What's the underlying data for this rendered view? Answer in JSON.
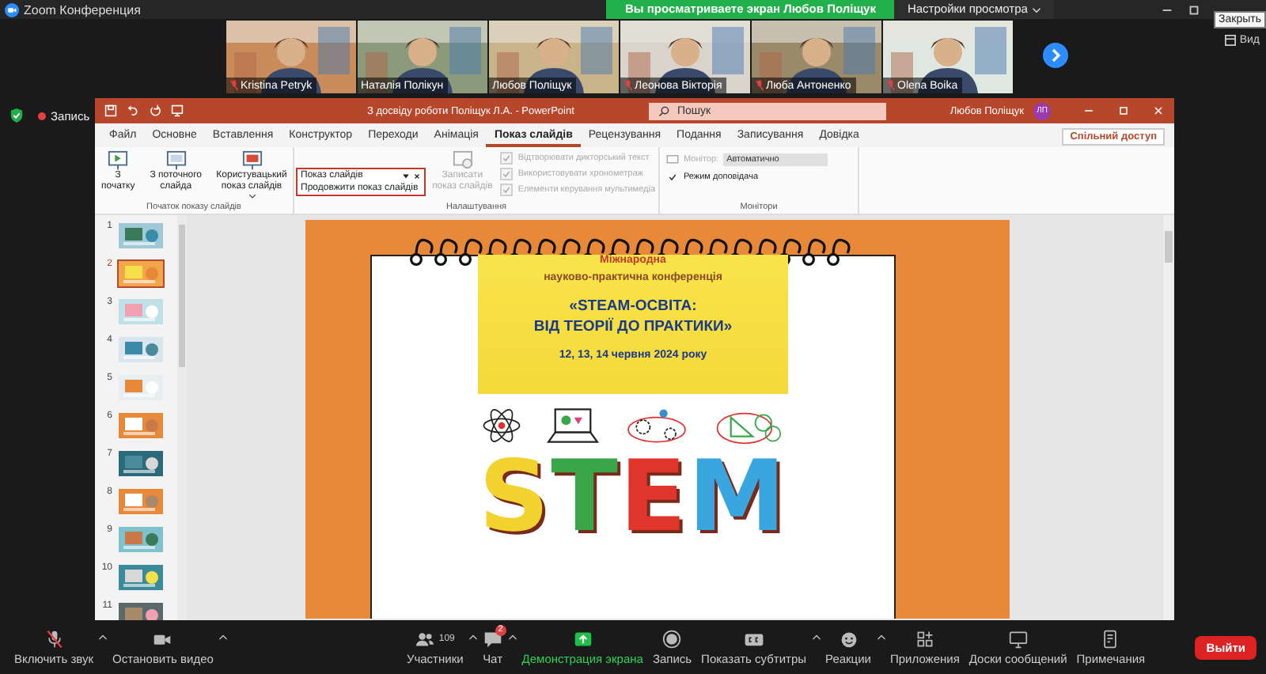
{
  "app": {
    "title": "Zoom Конференция",
    "banner": "Вы просматриваете экран Любов Поліщук",
    "view_options": "Настройки просмотра",
    "close_tooltip": "Закрыть",
    "view_button": "Вид"
  },
  "participants": [
    {
      "name": "Kristina Petryk",
      "muted": true
    },
    {
      "name": "Наталія Полікун",
      "muted": false
    },
    {
      "name": "Любов Поліщук",
      "muted": false
    },
    {
      "name": "Леонова Вікторія",
      "muted": true
    },
    {
      "name": "Люба Антоненко",
      "muted": true
    },
    {
      "name": "Olena Boika",
      "muted": true
    }
  ],
  "recording": {
    "label": "Запись"
  },
  "powerpoint": {
    "title": "З досвіду роботи Поліщук Л.А. - PowerPoint",
    "search_placeholder": "Пошук",
    "user": "Любов Поліщук",
    "avatar": "ЛП",
    "share": "Спільний доступ",
    "tabs": [
      {
        "label": "Файл",
        "selected": false
      },
      {
        "label": "Основне",
        "selected": false
      },
      {
        "label": "Вставлення",
        "selected": false
      },
      {
        "label": "Конструктор",
        "selected": false
      },
      {
        "label": "Переходи",
        "selected": false
      },
      {
        "label": "Анімація",
        "selected": false
      },
      {
        "label": "Показ слайдів",
        "selected": true
      },
      {
        "label": "Рецензування",
        "selected": false
      },
      {
        "label": "Подання",
        "selected": false
      },
      {
        "label": "Записування",
        "selected": false
      },
      {
        "label": "Довідка",
        "selected": false
      }
    ],
    "start_group": {
      "label": "Початок показу слайдів",
      "buttons": [
        {
          "label": "З початку",
          "caret": false
        },
        {
          "label": "З поточного слайда",
          "caret": false
        },
        {
          "label": "Користувацький показ слайдів",
          "caret": true
        }
      ]
    },
    "setup_group": {
      "label": "Налаштування",
      "record_button": {
        "label": "Записати показ слайдів",
        "disabled": true
      },
      "checkboxes": [
        {
          "label": "Відтворювати дикторський текст",
          "checked": true,
          "disabled": true
        },
        {
          "label": "Використовувати хронометраж",
          "checked": true,
          "disabled": true
        },
        {
          "label": "Елементи керування мультимедіа",
          "checked": true,
          "disabled": true
        }
      ]
    },
    "dropdown": {
      "value": "Показ слайдів",
      "option": "Продовжити показ слайдів"
    },
    "monitors_group": {
      "label": "Монітори",
      "monitor_label": "Монітор:",
      "monitor_value": "Автоматично",
      "presenter_view": {
        "label": "Режим доповідача",
        "checked": true
      }
    },
    "slides": [
      {
        "number": "1",
        "selected": false
      },
      {
        "number": "2",
        "selected": true
      },
      {
        "number": "3",
        "selected": false
      },
      {
        "number": "4",
        "selected": false
      },
      {
        "number": "5",
        "selected": false
      },
      {
        "number": "6",
        "selected": false
      },
      {
        "number": "7",
        "selected": false
      },
      {
        "number": "8",
        "selected": false
      },
      {
        "number": "9",
        "selected": false
      },
      {
        "number": "10",
        "selected": false
      },
      {
        "number": "11",
        "selected": false
      }
    ],
    "slide": {
      "line1": "Міжнародна",
      "line2": "науково-практична конференція",
      "title1": "«STEAM-ОСВІТА:",
      "title2": "ВІД ТЕОРІЇ ДО ПРАКТИКИ»",
      "date": "12, 13, 14 червня 2024 року",
      "letters": [
        {
          "char": "S",
          "color": "#f2d22e"
        },
        {
          "char": "T",
          "color": "#3aa64a"
        },
        {
          "char": "E",
          "color": "#e0352b"
        },
        {
          "char": "M",
          "color": "#3aa6df"
        }
      ]
    }
  },
  "toolbar": [
    {
      "kind": "mic",
      "label": "Включить звук",
      "caret": true
    },
    {
      "kind": "video",
      "label": "Остановить видео",
      "caret": true
    },
    {
      "kind": "participants",
      "label": "Участники",
      "count": "109",
      "caret": true
    },
    {
      "kind": "chat",
      "label": "Чат",
      "badge": "2",
      "caret": true
    },
    {
      "kind": "share",
      "label": "Демонстрация экрана",
      "caret": false
    },
    {
      "kind": "record",
      "label": "Запись",
      "caret": false
    },
    {
      "kind": "captions",
      "label": "Показать субтитры",
      "caret": true
    },
    {
      "kind": "reactions",
      "label": "Реакции",
      "caret": true
    },
    {
      "kind": "apps",
      "label": "Приложения",
      "caret": false
    },
    {
      "kind": "whiteboard",
      "label": "Доски сообщений",
      "caret": false
    },
    {
      "kind": "notes",
      "label": "Примечания",
      "caret": false
    }
  ],
  "leave_button": "Выйти"
}
